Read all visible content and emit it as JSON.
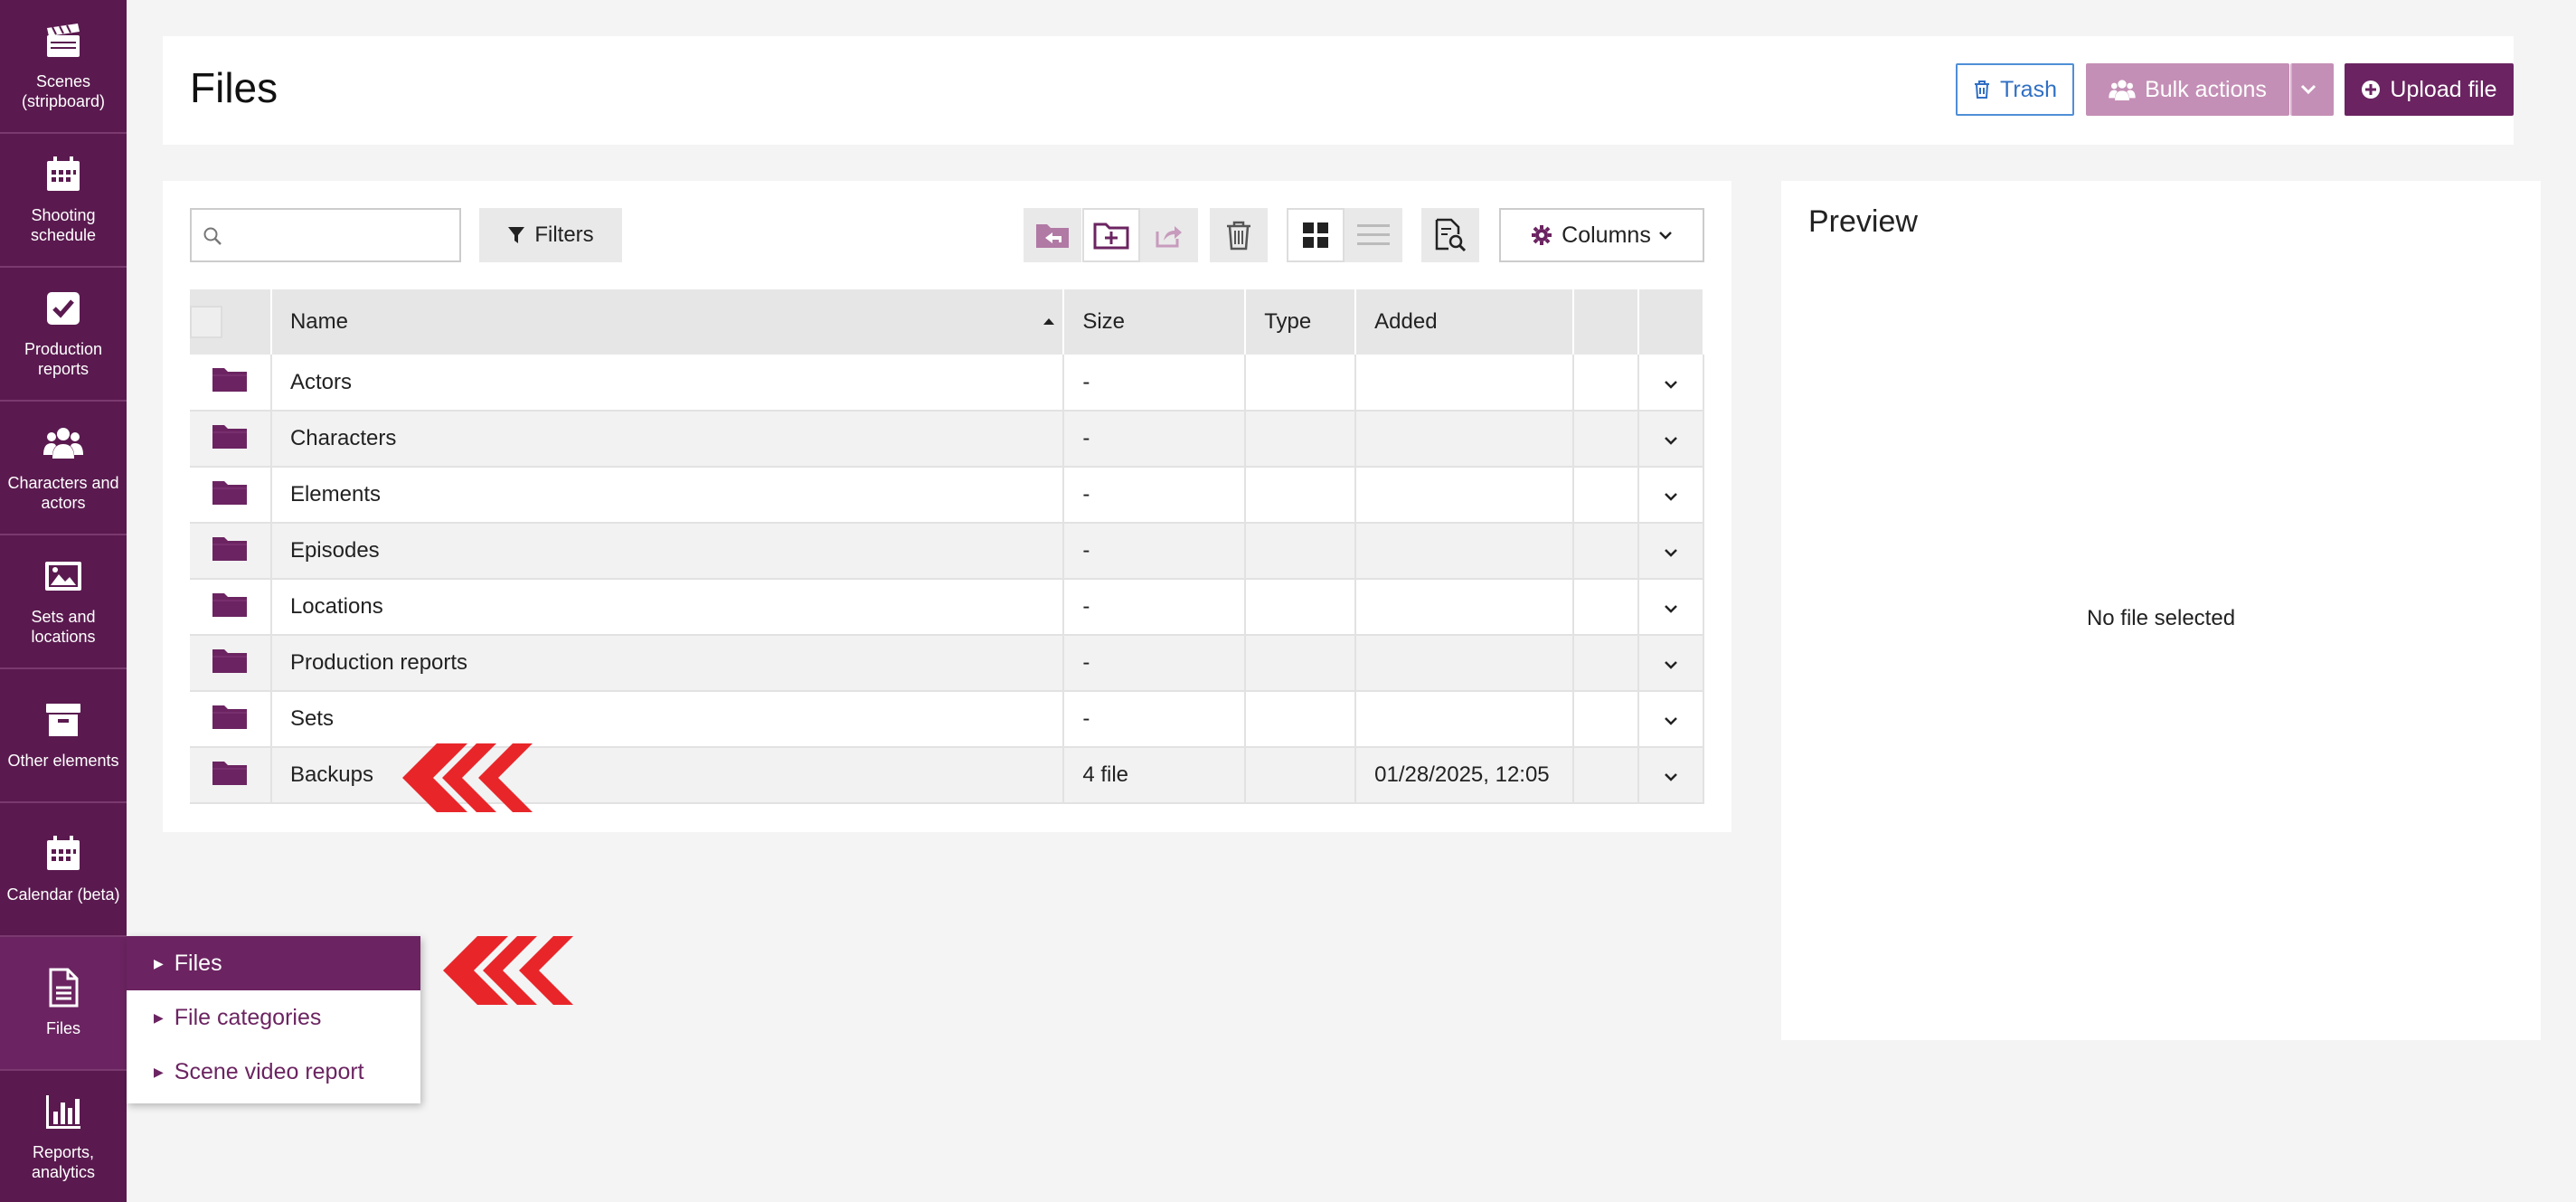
{
  "sidebar": {
    "items": [
      {
        "label": "Scenes (stripboard)",
        "icon": "clapperboard-icon"
      },
      {
        "label": "Shooting schedule",
        "icon": "calendar-icon"
      },
      {
        "label": "Production reports",
        "icon": "check-square-icon"
      },
      {
        "label": "Characters and actors",
        "icon": "users-icon"
      },
      {
        "label": "Sets and locations",
        "icon": "image-icon"
      },
      {
        "label": "Other elements",
        "icon": "archive-icon"
      },
      {
        "label": "Calendar (beta)",
        "icon": "calendar-icon"
      },
      {
        "label": "Files",
        "icon": "file-icon"
      },
      {
        "label": "Reports, analytics",
        "icon": "bar-chart-icon"
      }
    ]
  },
  "header": {
    "title": "Files",
    "trash_label": "Trash",
    "bulk_label": "Bulk actions",
    "upload_label": "Upload file"
  },
  "toolbar": {
    "search_placeholder": "",
    "filters_label": "Filters",
    "columns_label": "Columns"
  },
  "table": {
    "headers": [
      "Name",
      "Size",
      "Type",
      "Added"
    ],
    "rows": [
      {
        "name": "Actors",
        "size": "-",
        "type": "",
        "added": ""
      },
      {
        "name": "Characters",
        "size": "-",
        "type": "",
        "added": ""
      },
      {
        "name": "Elements",
        "size": "-",
        "type": "",
        "added": ""
      },
      {
        "name": "Episodes",
        "size": "-",
        "type": "",
        "added": ""
      },
      {
        "name": "Locations",
        "size": "-",
        "type": "",
        "added": ""
      },
      {
        "name": "Production reports",
        "size": "-",
        "type": "",
        "added": ""
      },
      {
        "name": "Sets",
        "size": "-",
        "type": "",
        "added": ""
      },
      {
        "name": "Backups",
        "size": "4 file",
        "type": "",
        "added": "01/28/2025, 12:05"
      }
    ]
  },
  "preview": {
    "title": "Preview",
    "empty_text": "No file selected"
  },
  "submenu": {
    "items": [
      "Files",
      "File categories",
      "Scene video report"
    ],
    "active": "Files"
  },
  "colors": {
    "brand": "#5a1a4f",
    "brand_active": "#6b2461",
    "bulk": "#c48fb6",
    "trash": "#2f6fc4",
    "folder": "#6b2461",
    "annotation": "#e8262a"
  }
}
